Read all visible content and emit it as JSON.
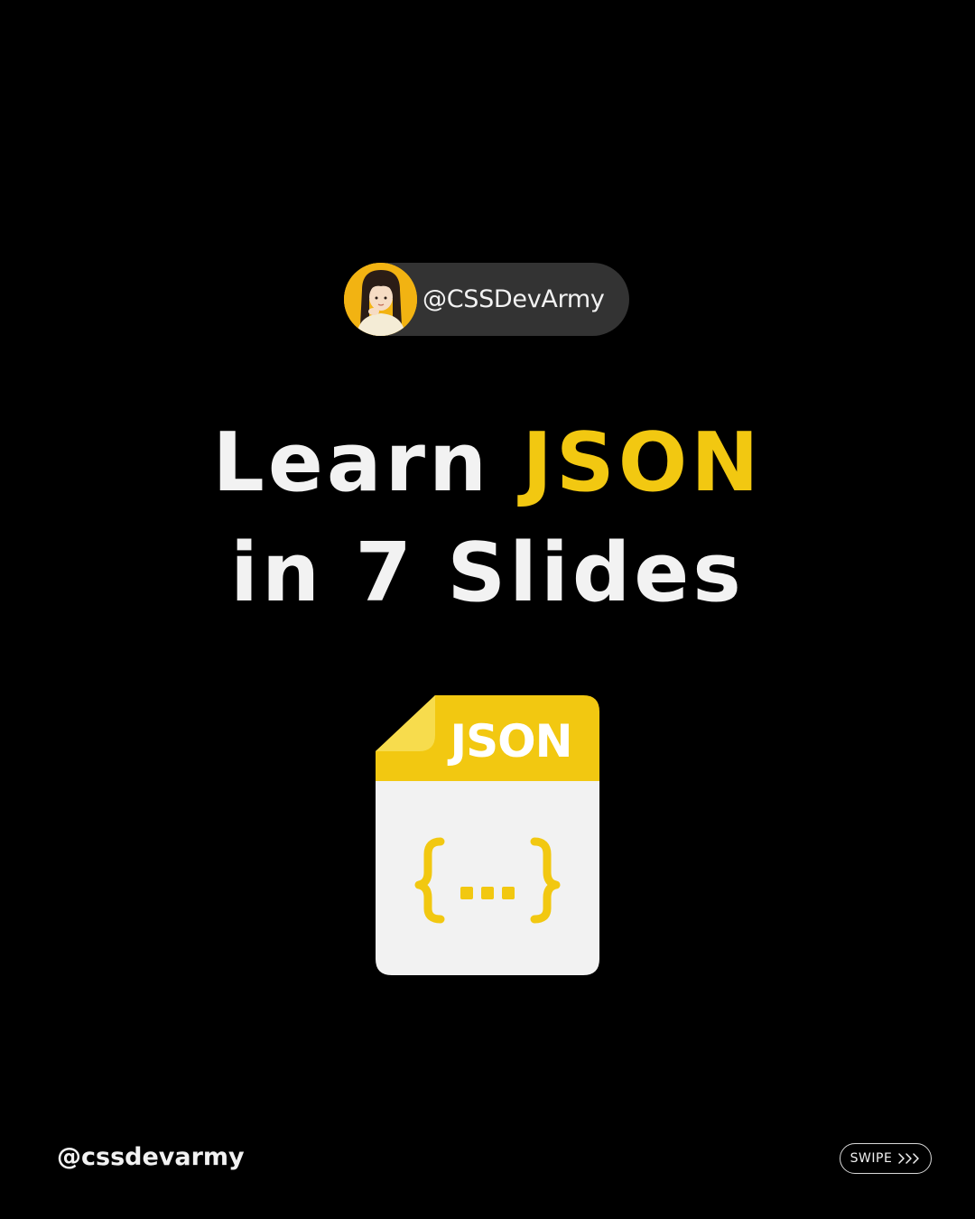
{
  "author": {
    "handle": "@CSSDevArmy",
    "avatar_icon": "girl-avatar-icon"
  },
  "headline": {
    "line1_prefix": "Learn",
    "line1_accent": "JSON",
    "line2": "in 7 Slides"
  },
  "file_icon": {
    "label": "JSON",
    "symbol": "{...}",
    "icon": "json-file-icon"
  },
  "footer": {
    "handle": "@cssdevarmy",
    "swipe_label": "SWIPE",
    "swipe_icon": "chevrons-right-icon"
  },
  "colors": {
    "background": "#000000",
    "accent": "#f2c811",
    "pill": "#333333",
    "text": "#f2f2f2",
    "file_body": "#f2f2f2"
  }
}
